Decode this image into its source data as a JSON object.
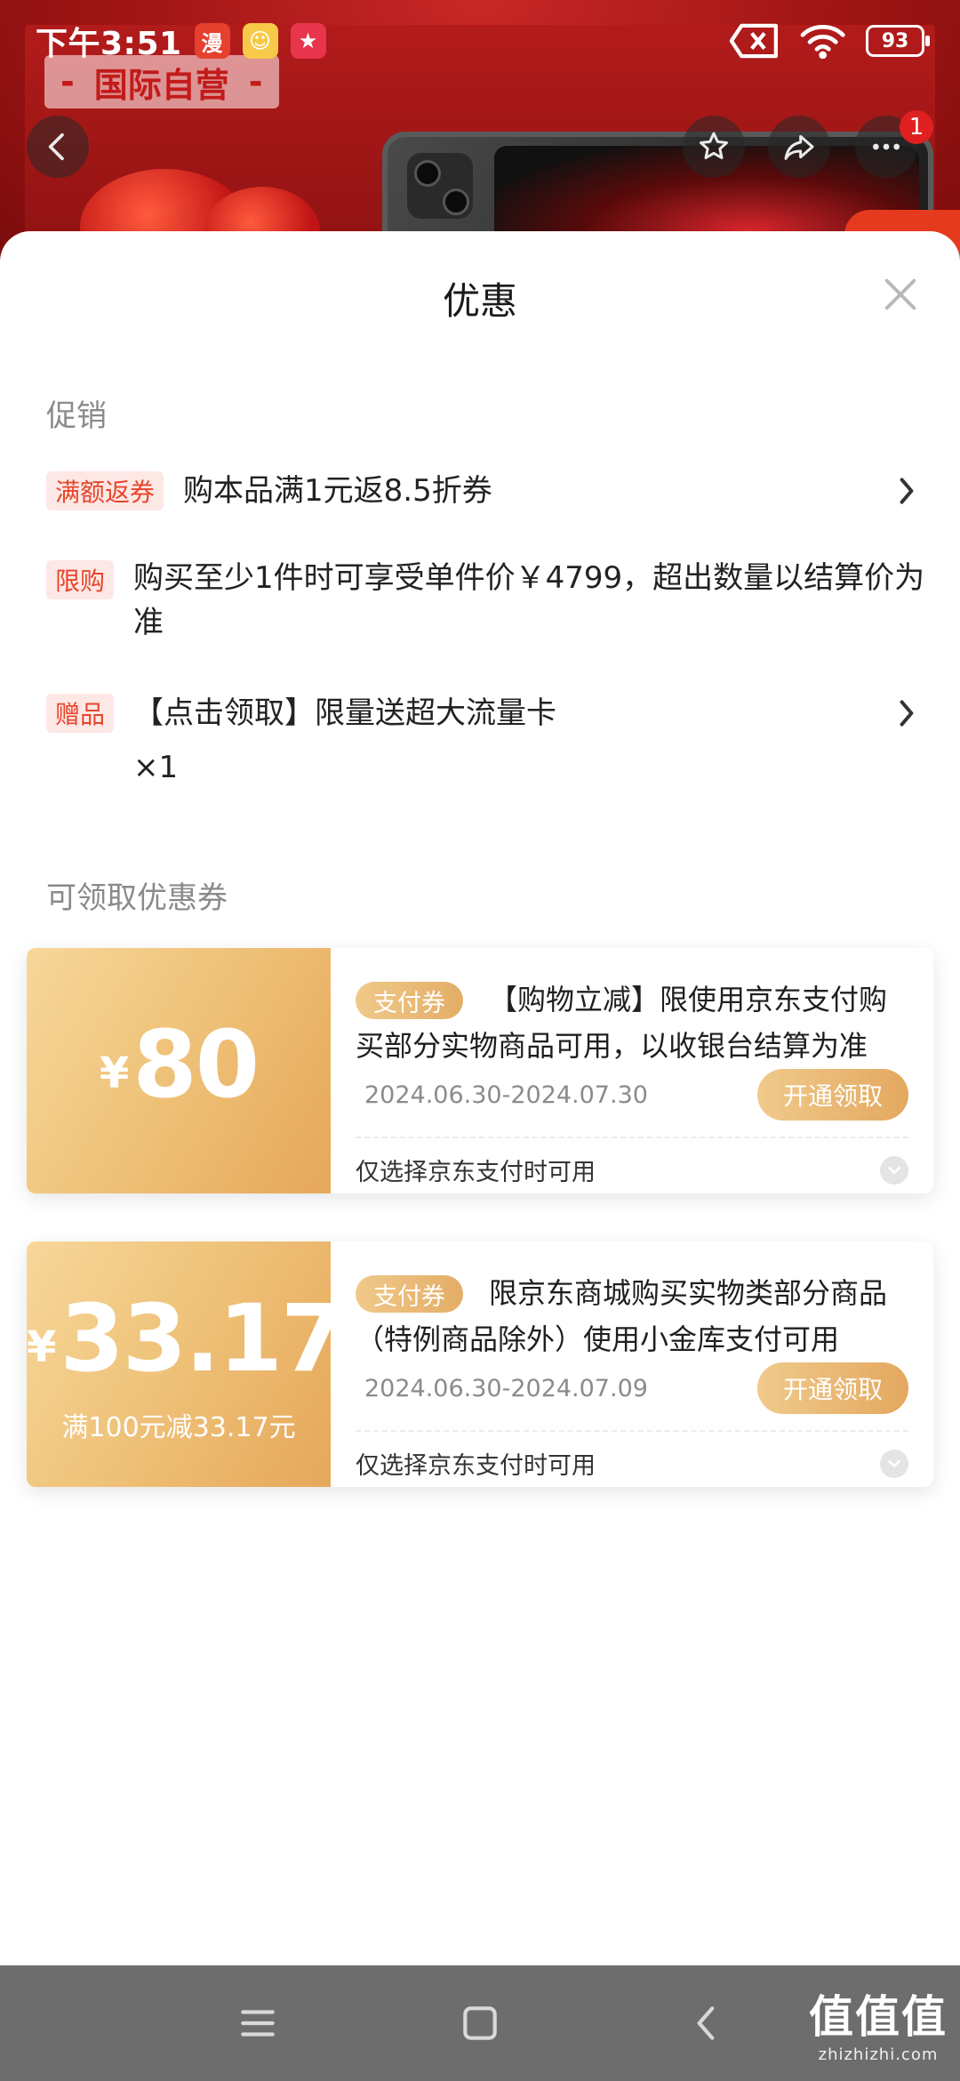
{
  "status_bar": {
    "time": "下午3:51",
    "apps": [
      {
        "name": "manga-app-icon",
        "glyph": "漫"
      },
      {
        "name": "cartoon-app-icon",
        "glyph": "☺"
      },
      {
        "name": "red-app-icon",
        "glyph": "★"
      }
    ],
    "battery": "93"
  },
  "background_page": {
    "brand_banner": "国际自营",
    "more_badge": "1"
  },
  "sheet": {
    "title": "优惠",
    "promotion_section_title": "促销",
    "promotions": [
      {
        "tag": "满额返券",
        "text": "购本品满1元返8.5折券",
        "has_arrow": true
      },
      {
        "tag": "限购",
        "text": "购买至少1件时可享受单件价￥4799，超出数量以结算价为准",
        "has_arrow": false
      },
      {
        "tag": "赠品",
        "text": "【点击领取】限量送超大流量卡",
        "sub_text": "×1",
        "has_arrow": true
      }
    ],
    "coupon_section_title": "可领取优惠券",
    "coupons": [
      {
        "currency": "¥",
        "amount": "80",
        "condition": "",
        "tag": "支付券",
        "description": "【购物立减】限使用京东支付购买部分实物商品可用，以收银台结算为准",
        "date_range": "2024.06.30-2024.07.30",
        "button": "开通领取",
        "note": "仅选择京东支付时可用"
      },
      {
        "currency": "¥",
        "amount": "33.17",
        "condition": "满100元减33.17元",
        "tag": "支付券",
        "description": "限京东商城购买实物类部分商品（特例商品除外）使用小金库支付可用",
        "date_range": "2024.06.30-2024.07.09",
        "button": "开通领取",
        "note": "仅选择京东支付时可用"
      }
    ]
  },
  "watermark": {
    "main": "值值值",
    "sub": "zhizhizhi.com"
  },
  "colors": {
    "accent_red": "#e8452c",
    "coupon_gold": "#e6a75a",
    "nav_bar": "#6d6d6d"
  }
}
